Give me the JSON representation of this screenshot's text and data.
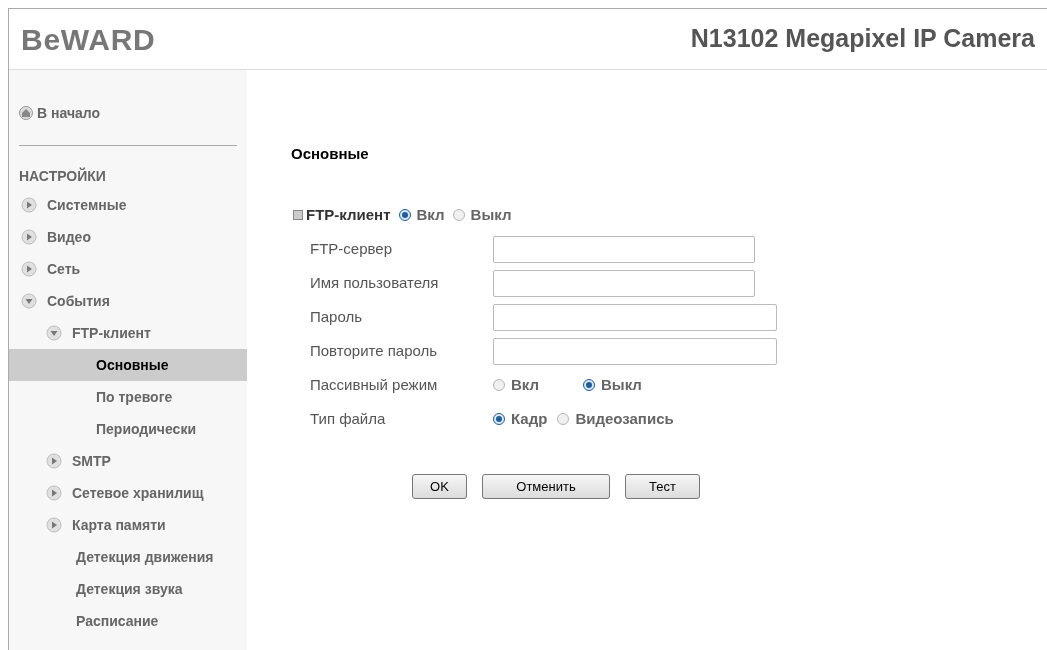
{
  "header": {
    "logo": "BeWARD",
    "title": "N13102 Megapixel IP Camera"
  },
  "sidebar": {
    "home": "В начало",
    "section": "НАСТРОЙКИ",
    "items": [
      {
        "label": "Системные",
        "kind": "branch",
        "expanded": false,
        "selected": false
      },
      {
        "label": "Видео",
        "kind": "branch",
        "expanded": false,
        "selected": false
      },
      {
        "label": "Сеть",
        "kind": "branch",
        "expanded": false,
        "selected": false
      },
      {
        "label": "События",
        "kind": "branch",
        "expanded": true,
        "selected": false,
        "children": [
          {
            "label": "FTP-клиент",
            "kind": "branch",
            "expanded": true,
            "selected": false,
            "children": [
              {
                "label": "Основные",
                "kind": "leaf",
                "selected": true
              },
              {
                "label": "По тревоге",
                "kind": "leaf",
                "selected": false
              },
              {
                "label": "Периодически",
                "kind": "leaf",
                "selected": false
              }
            ]
          },
          {
            "label": "SMTP",
            "kind": "branch",
            "expanded": false,
            "selected": false
          },
          {
            "label": "Сетевое хранилищ",
            "kind": "branch",
            "expanded": false,
            "selected": false
          },
          {
            "label": "Карта памяти",
            "kind": "branch",
            "expanded": false,
            "selected": false
          },
          {
            "label": "Детекция движения",
            "kind": "leaf",
            "selected": false
          },
          {
            "label": "Детекция звука",
            "kind": "leaf",
            "selected": false
          },
          {
            "label": "Расписание",
            "kind": "leaf",
            "selected": false
          }
        ]
      }
    ]
  },
  "form": {
    "title": "Основные",
    "group": {
      "label": "FTP-клиент",
      "options": [
        {
          "label": "Вкл",
          "selected": true
        },
        {
          "label": "Выкл",
          "selected": false
        }
      ]
    },
    "fields": [
      {
        "kind": "text",
        "label": "FTP-сервер"
      },
      {
        "kind": "text",
        "label": "Имя пользователя"
      },
      {
        "kind": "password",
        "label": "Пароль"
      },
      {
        "kind": "password",
        "label": "Повторите пароль"
      },
      {
        "kind": "radio",
        "label": "Пассивный режим",
        "options": [
          {
            "label": "Вкл",
            "selected": false
          },
          {
            "label": "Выкл",
            "selected": true
          }
        ]
      },
      {
        "kind": "radio",
        "label": "Тип файла",
        "options": [
          {
            "label": "Кадр",
            "selected": true
          },
          {
            "label": "Видеозапись",
            "selected": false
          }
        ]
      }
    ],
    "buttons": [
      "OK",
      "Отменить",
      "Тест"
    ]
  }
}
